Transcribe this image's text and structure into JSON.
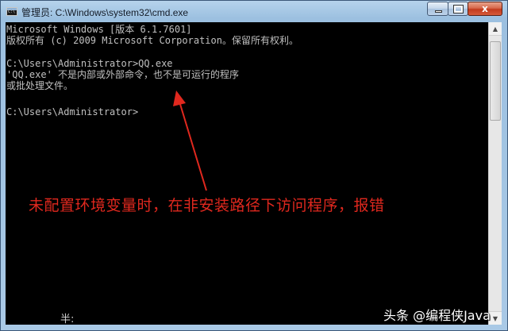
{
  "window": {
    "title": "管理员: C:\\Windows\\system32\\cmd.exe",
    "icon": "cmd-icon",
    "controls": {
      "minimize": "minimize-icon",
      "maximize": "maximize-icon",
      "close": "close-icon",
      "close_glyph": "x"
    }
  },
  "console": {
    "lines": [
      "Microsoft Windows [版本 6.1.7601]",
      "版权所有 (c) 2009 Microsoft Corporation。保留所有权利。",
      "",
      "C:\\Users\\Administrator>QQ.exe",
      "'QQ.exe' 不是内部或外部命令，也不是可运行的程序",
      "或批处理文件。",
      "",
      "C:\\Users\\Administrator>"
    ],
    "text_color": "#c0c0c0",
    "background": "#000000"
  },
  "annotation": {
    "text": "未配置环境变量时，在非安装路径下访问程序，报错",
    "color": "#e0281e"
  },
  "ime_status": "半:",
  "watermark": "头条 @编程侠Java"
}
